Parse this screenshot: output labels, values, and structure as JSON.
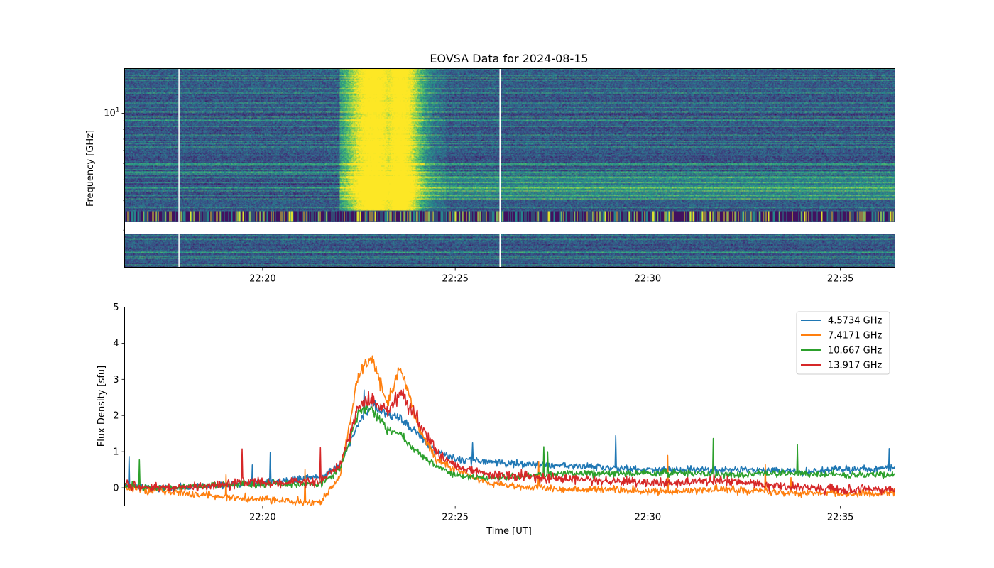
{
  "chart_data": [
    {
      "type": "heatmap",
      "title": "EOVSA Data for 2024-08-15",
      "xlabel": "",
      "ylabel": "Frequency [GHz]",
      "y_scale": "log",
      "y_tick_labels": [
        {
          "value": 10,
          "base": "10",
          "exp": "1"
        }
      ],
      "x_tick_labels": [
        "22:20",
        "22:25",
        "22:30",
        "22:35"
      ],
      "xlim": [
        "22:16:25",
        "22:36:25"
      ],
      "colormap": [
        "#440154",
        "#3b528b",
        "#21918c",
        "#5ec962",
        "#fde725"
      ],
      "features": {
        "burst_window": [
          "22:22",
          "22:24:45"
        ],
        "burst_peaks": [
          "22:22:50",
          "22:23:35"
        ],
        "data_gaps": [
          "22:17:50",
          "22:26:10"
        ]
      }
    },
    {
      "type": "line",
      "title": "",
      "xlabel": "Time [UT]",
      "ylabel": "Flux Density [sfu]",
      "ylim": [
        -0.5,
        5
      ],
      "y_ticks": [
        0,
        1,
        2,
        3,
        4,
        5
      ],
      "x_tick_labels": [
        "22:20",
        "22:25",
        "22:30",
        "22:35"
      ],
      "xlim": [
        "22:16:25",
        "22:36:25"
      ],
      "grid": false,
      "legend": "top-right",
      "x": [
        "22:16:25",
        "22:17:30",
        "22:18:30",
        "22:19:30",
        "22:20:30",
        "22:21:30",
        "22:22:00",
        "22:22:30",
        "22:22:50",
        "22:23:15",
        "22:23:35",
        "22:24:00",
        "22:24:30",
        "22:25:00",
        "22:25:30",
        "22:26:00",
        "22:27:00",
        "22:28:00",
        "22:29:00",
        "22:30:00",
        "22:31:00",
        "22:32:00",
        "22:33:00",
        "22:34:00",
        "22:35:00",
        "22:36:25"
      ],
      "series": [
        {
          "name": "4.5734 GHz",
          "color": "#1f77b4",
          "values": [
            0.05,
            0.0,
            0.05,
            0.1,
            0.2,
            0.3,
            0.6,
            1.8,
            2.3,
            2.0,
            1.9,
            1.5,
            1.0,
            0.8,
            0.75,
            0.7,
            0.65,
            0.6,
            0.55,
            0.5,
            0.5,
            0.5,
            0.5,
            0.45,
            0.5,
            0.55
          ]
        },
        {
          "name": "7.4171 GHz",
          "color": "#ff7f0e",
          "values": [
            0.0,
            -0.1,
            -0.2,
            -0.3,
            -0.35,
            -0.4,
            0.3,
            3.2,
            3.6,
            2.3,
            3.4,
            1.8,
            0.8,
            0.5,
            0.3,
            0.1,
            0.0,
            -0.05,
            -0.05,
            -0.1,
            -0.1,
            -0.05,
            -0.1,
            -0.15,
            -0.15,
            -0.15
          ]
        },
        {
          "name": "10.667 GHz",
          "color": "#2ca02c",
          "values": [
            0.05,
            0.0,
            0.05,
            0.1,
            0.1,
            0.1,
            0.5,
            2.1,
            2.2,
            1.6,
            1.5,
            1.0,
            0.6,
            0.35,
            0.3,
            0.25,
            0.35,
            0.4,
            0.4,
            0.4,
            0.4,
            0.35,
            0.4,
            0.4,
            0.35,
            0.35
          ]
        },
        {
          "name": "13.917 GHz",
          "color": "#d62728",
          "values": [
            0.05,
            0.0,
            0.05,
            0.15,
            0.15,
            0.2,
            0.6,
            2.3,
            2.4,
            2.1,
            2.6,
            1.9,
            1.0,
            0.6,
            0.45,
            0.35,
            0.3,
            0.25,
            0.2,
            0.15,
            0.15,
            0.2,
            0.1,
            0.0,
            -0.05,
            -0.05
          ]
        }
      ]
    }
  ]
}
